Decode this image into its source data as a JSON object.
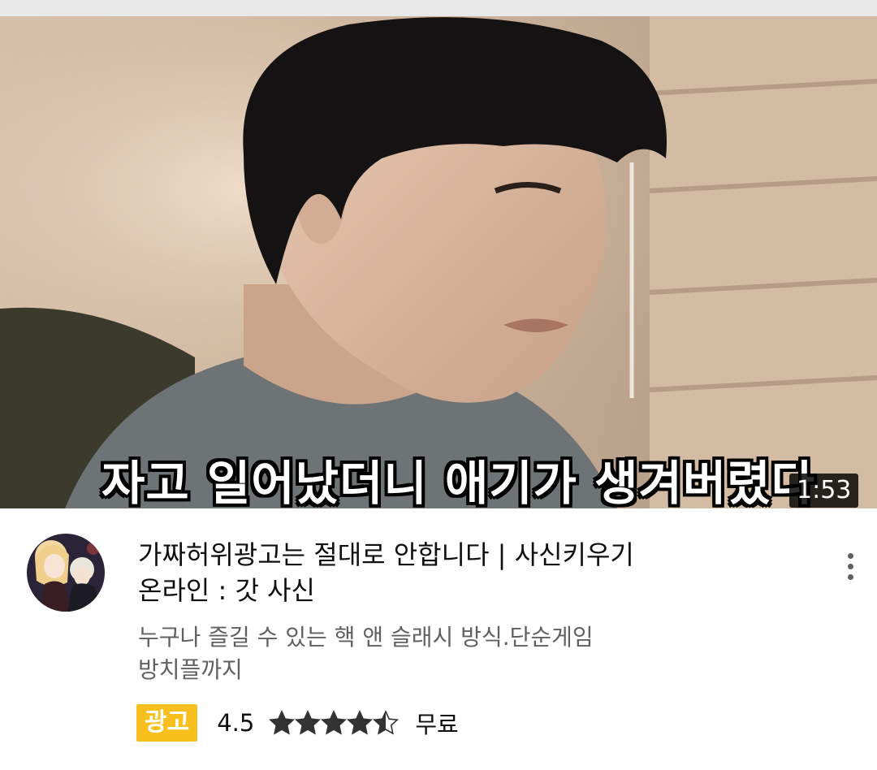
{
  "video": {
    "caption": "자고 일어났더니 애기가 생겨버렸다",
    "duration": "1:53"
  },
  "ad": {
    "title_line1": "가짜허위광고는 절대로 안합니다 | 사신키우기",
    "title_line2": "온라인 : 갓 사신",
    "description_line1": "누구나 즐길 수 있는 핵 앤 슬래시 방식.단순게임",
    "description_line2": "방치플까지",
    "badge": "광고",
    "rating": "4.5",
    "rating_value": 4.5,
    "rating_max": 5,
    "price": "무료"
  },
  "icons": {
    "menu": "more-vert-icon",
    "star": "star-icon"
  },
  "colors": {
    "badge": "#f9c01d",
    "title": "#0f0f0f",
    "description": "#606060"
  }
}
